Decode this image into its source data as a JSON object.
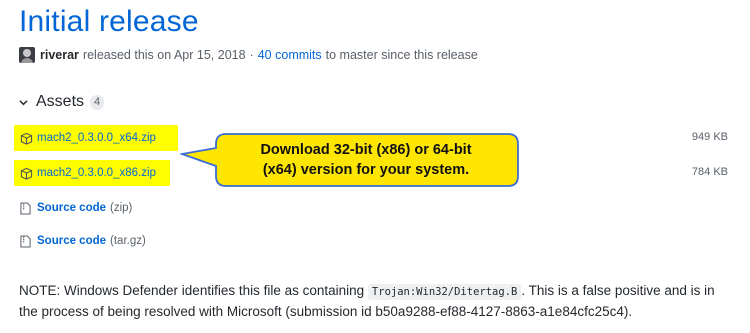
{
  "release": {
    "title": "Initial release",
    "author": "riverar",
    "released_text": "released this on Apr 15, 2018",
    "separator": "·",
    "commits_link": "40 commits",
    "commits_suffix": "to master since this release"
  },
  "assets": {
    "header": "Assets",
    "count": "4",
    "files": [
      {
        "name": "mach2_0.3.0.0_x64.zip",
        "size": "949 KB"
      },
      {
        "name": "mach2_0.3.0.0_x86.zip",
        "size": "784 KB"
      }
    ],
    "source": [
      {
        "label": "Source code",
        "ext": "(zip)"
      },
      {
        "label": "Source code",
        "ext": "(tar.gz)"
      }
    ]
  },
  "callout": {
    "line1": "Download 32-bit (x86) or 64-bit",
    "line2": "(x64) version for your system."
  },
  "note": {
    "prefix": "NOTE: Windows Defender identifies this file as containing ",
    "code": "Trojan:Win32/Ditertag.B",
    "suffix": ". This is a false positive and is in the process of being resolved with Microsoft (submission id b50a9288-ef88-4127-8863-a1e84cfc25c4)."
  },
  "colors": {
    "link": "#0366d6",
    "highlight": "#fffe00",
    "callout_fill": "#ffe600",
    "callout_border": "#3a6bd6"
  }
}
